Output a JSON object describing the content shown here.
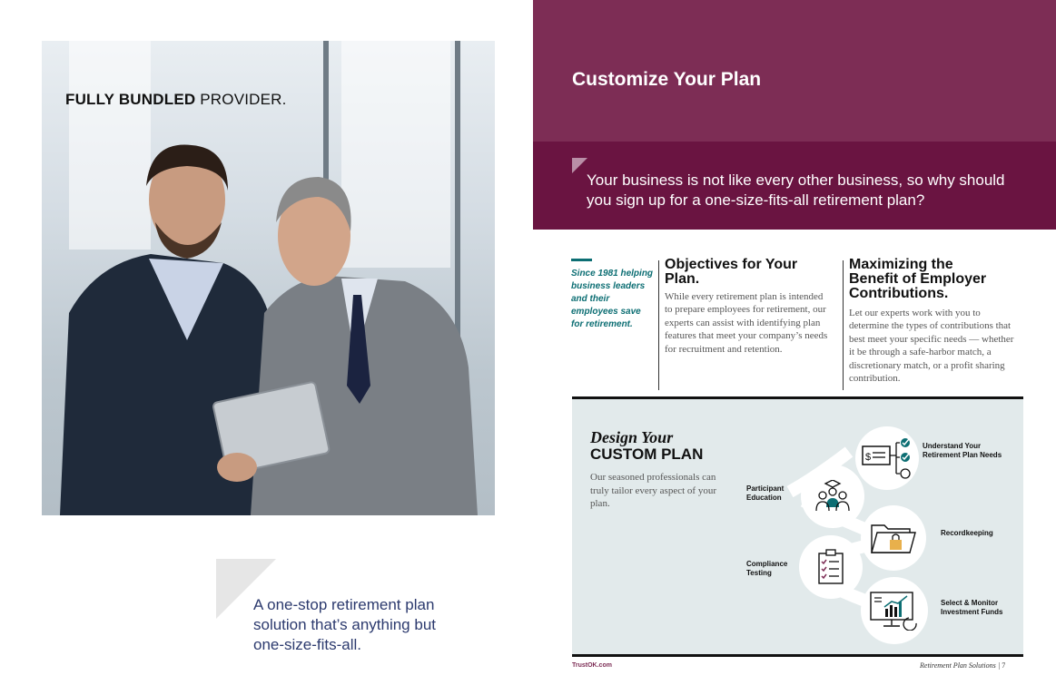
{
  "left_page": {
    "photo_title_bold": "FULLY BUNDLED",
    "photo_title_rest": " PROVIDER.",
    "quote": "A one-stop retirement plan solution that’s anything but one-size-fits-all."
  },
  "right_page": {
    "header_title": "Customize Your Plan",
    "sub_heading": "Your business is not like every other business, so why should you sign up for a one-size-fits-all retirement plan?",
    "since_note": "Since 1981 helping business leaders and their employees save for retirement.",
    "columns": [
      {
        "heading": "Objectives for Your Plan.",
        "body": "While every retirement plan is intended to prepare employees for retirement, our experts can assist with identifying plan features that meet your company’s needs for recruitment and retention."
      },
      {
        "heading": "Maximizing the Benefit of Employer Contributions.",
        "body": "Let our experts work with you to determine the types of contributions that best meet your specific needs — whether it be through a safe-harbor match, a discretionary match, or a profit sharing contribution."
      }
    ],
    "design": {
      "title_italic": "Design Your",
      "title_caps": "CUSTOM PLAN",
      "body": "Our seasoned professionals can truly tailor every aspect of your plan.",
      "steps": [
        {
          "label": "Understand Your Retirement Plan Needs",
          "icon": "checklist-icon"
        },
        {
          "label": "Participant Education",
          "icon": "graduates-icon"
        },
        {
          "label": "Recordkeeping",
          "icon": "locked-folder-icon"
        },
        {
          "label": "Compliance Testing",
          "icon": "clipboard-checklist-icon"
        },
        {
          "label": "Select & Monitor Investment Funds",
          "icon": "monitor-chart-icon"
        }
      ]
    },
    "footer": {
      "site": "TrustOK.com",
      "title": "Retirement Plan Solutions",
      "page": "| 7"
    }
  },
  "colors": {
    "header_band": "#7d2d55",
    "sub_band": "#6a1441",
    "teal": "#0c6e73",
    "panel": "#e2eaeb",
    "quote_blue": "#2c3a6e"
  }
}
